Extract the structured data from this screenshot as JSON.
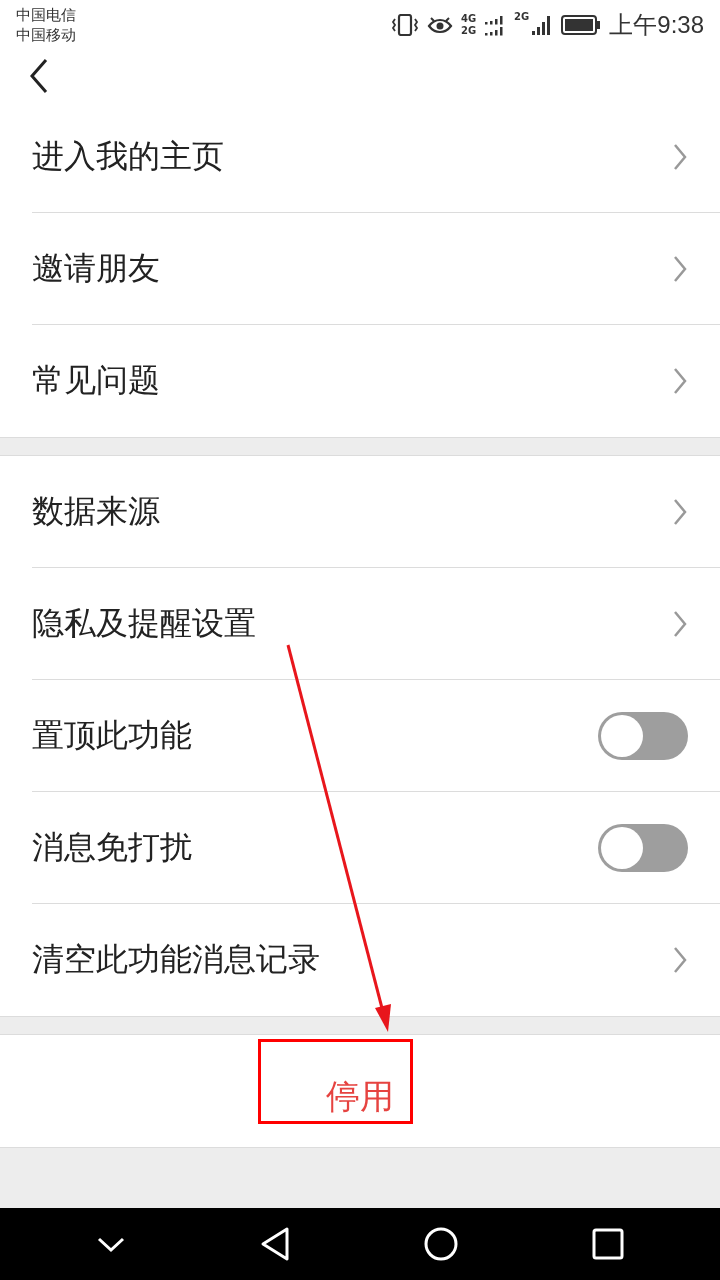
{
  "status_bar": {
    "carriers": [
      "中国电信",
      "中国移动"
    ],
    "network_labels": [
      "4G",
      "2G",
      "2G"
    ],
    "time": "上午9:38"
  },
  "groups": [
    {
      "rows": [
        {
          "kind": "link",
          "label": "进入我的主页"
        },
        {
          "kind": "link",
          "label": "邀请朋友"
        },
        {
          "kind": "link",
          "label": "常见问题"
        }
      ]
    },
    {
      "rows": [
        {
          "kind": "link",
          "label": "数据来源"
        },
        {
          "kind": "link",
          "label": "隐私及提醒设置"
        },
        {
          "kind": "toggle",
          "label": "置顶此功能",
          "on": false
        },
        {
          "kind": "toggle",
          "label": "消息免打扰",
          "on": false
        },
        {
          "kind": "link",
          "label": "清空此功能消息记录"
        }
      ]
    }
  ],
  "disable_button": {
    "label": "停用"
  }
}
